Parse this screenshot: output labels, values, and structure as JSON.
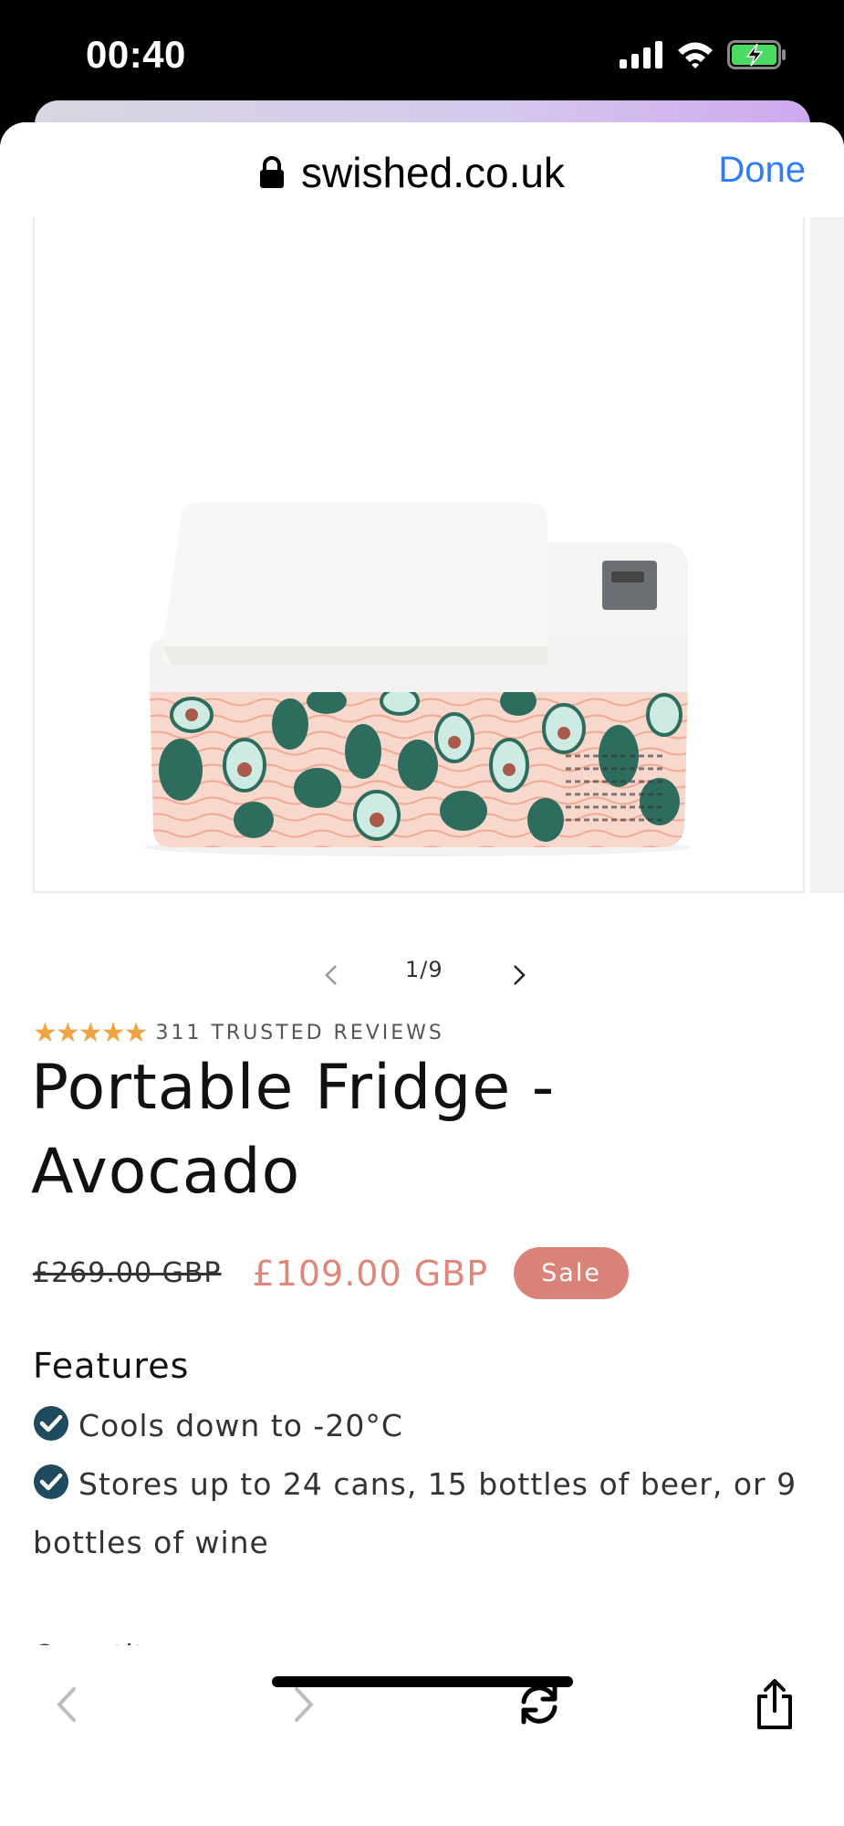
{
  "status_bar": {
    "time": "00:40",
    "icons": [
      "signal-icon",
      "wifi-icon",
      "battery-charging-icon"
    ]
  },
  "browser": {
    "url": "swished.co.uk",
    "done_label": "Done",
    "lock_icon": "lock-icon"
  },
  "gallery": {
    "counter": "1/9",
    "prev_icon": "chevron-left-icon",
    "next_icon": "chevron-right-icon",
    "image_alt": "Portable fridge with avocado print"
  },
  "product": {
    "stars": "★★★★★",
    "reviews": "311 TRUSTED REVIEWS",
    "title": "Portable Fridge - Avocado",
    "old_price": "£269.00 GBP",
    "new_price": "£109.00 GBP",
    "sale_badge": "Sale",
    "features_heading": "Features",
    "features": [
      "Cools down to -20°C",
      "Stores up to 24 cans, 15 bottles of beer, or 9 bottles of wine"
    ],
    "quantity_label": "Quantity"
  },
  "toolbar": {
    "back_icon": "back-arrow-icon",
    "forward_icon": "forward-arrow-icon",
    "reload_icon": "reload-icon",
    "share_icon": "share-icon"
  },
  "colors": {
    "accent": "#2f7cf6",
    "sale": "#d98277",
    "price": "#dc8779",
    "stars": "#f0a341",
    "check": "#1f4b5e"
  }
}
